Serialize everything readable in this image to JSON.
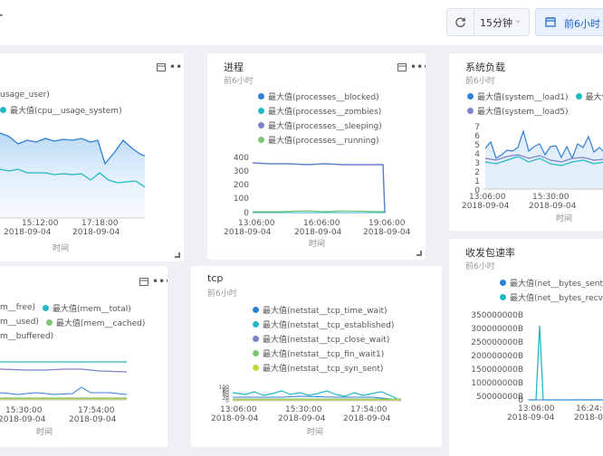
{
  "header": {
    "title": "r",
    "refresh_interval": "15分钟",
    "time_range": "前6小时"
  },
  "colors": {
    "blue": "#2f7fd5",
    "cyan": "#23b8c4",
    "purple": "#7b83c9",
    "green": "#7ec473",
    "yellow": "#c8d23c",
    "accent": "#1a5ed6"
  },
  "panels": {
    "cpu": {
      "legend": [
        "usage_user)",
        "最大值(cpu__usage_system)"
      ],
      "ticks": [
        "15:12:00",
        "17:18:00"
      ],
      "dates": [
        "2018-09-04",
        "2018-09-04"
      ],
      "axis_label": "时间"
    },
    "process": {
      "title": "进程",
      "subtitle": "前6小时",
      "legend": [
        "最大值(processes__blocked)",
        "最大值(processes__zombies)",
        "最大值(processes__sleeping)",
        "最大值(processes__running)"
      ],
      "yticks": [
        "400",
        "300",
        "200",
        "100",
        "0"
      ],
      "ticks": [
        "13:06:00",
        "16:06:00",
        "19:06:00"
      ],
      "dates": [
        "2018-09-04",
        "2018-09-04",
        "2018-09-04"
      ],
      "axis_label": "时间"
    },
    "load": {
      "title": "系统负载",
      "subtitle": "前6小时",
      "legend": [
        "最大值(system__load1)",
        "最大值(",
        "最大值(system__load5)"
      ],
      "yticks": [
        "7",
        "6",
        "5",
        "4",
        "3",
        "2",
        "1",
        "0"
      ],
      "ticks": [
        "13:06:00",
        "15:30:00"
      ],
      "dates": [
        "2018-09-04",
        "2018-09-04"
      ],
      "axis_label": "时间"
    },
    "mem": {
      "legend": [
        "m__free)",
        "最大值(mem__total)",
        "m__used)",
        "最大值(mem__cached)",
        "m__buffered)"
      ],
      "ticks": [
        "15:30:00",
        "17:54:00"
      ],
      "dates": [
        "2018-09-04",
        "2018-09-04"
      ],
      "axis_label": "时间"
    },
    "tcp": {
      "title": "tcp",
      "subtitle": "前6小时",
      "legend": [
        "最大值(netstat__tcp_time_wait)",
        "最大值(netstat__tcp_established)",
        "最大值(netstat__tcp_close_wait)",
        "最大值(netstat__tcp_fin_wait1)",
        "最大值(netstat__tcp_syn_sent)"
      ],
      "yticks": [
        "100",
        "80",
        "60",
        "40",
        "20",
        "0"
      ],
      "ticks": [
        "13:06:00",
        "15:30:00",
        "17:54:00"
      ],
      "dates": [
        "2018-09-04",
        "2018-09-04",
        "2018-09-04"
      ],
      "axis_label": "时间"
    },
    "net": {
      "title": "收发包速率",
      "subtitle": "前6小时",
      "legend": [
        "最大值(net__bytes_sent_p",
        "最大值(net__bytes_recv_p"
      ],
      "yticks": [
        "350000000B",
        "300000000B",
        "250000000B",
        "200000000B",
        "150000000B",
        "100000000B",
        "50000000B",
        "0"
      ],
      "ticks": [
        "13:06:00",
        "16:24:0"
      ],
      "dates": [
        "2018-09-04",
        "2018-09-04"
      ]
    }
  }
}
